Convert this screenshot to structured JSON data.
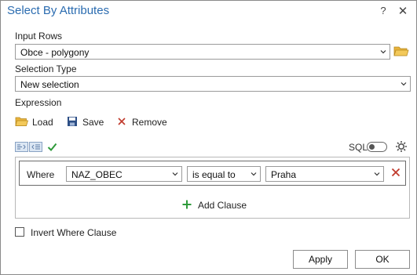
{
  "window": {
    "title": "Select By Attributes",
    "help_label": "?",
    "close_label": "✕"
  },
  "input_rows": {
    "label": "Input Rows",
    "value": "Obce - polygony"
  },
  "selection_type": {
    "label": "Selection Type",
    "value": "New selection"
  },
  "expression": {
    "label": "Expression",
    "load_label": "Load",
    "save_label": "Save",
    "remove_label": "Remove",
    "sql_label": "SQL",
    "sql_enabled": false
  },
  "clause": {
    "where_label": "Where",
    "field": "NAZ_OBEC",
    "operator": "is equal to",
    "value": "Praha"
  },
  "add_clause_label": "Add Clause",
  "invert": {
    "label": "Invert Where Clause",
    "checked": false
  },
  "buttons": {
    "apply": "Apply",
    "ok": "OK"
  },
  "colors": {
    "title": "#2b6cb0",
    "folder": "#e8b33c",
    "remove_x": "#c0392b",
    "add_plus": "#2e9a3a",
    "check": "#2e9a3a",
    "save_disk": "#2d4f86"
  },
  "icons": [
    "help-icon",
    "close-icon",
    "folder-icon",
    "chevron-down-icon",
    "load-icon",
    "save-icon",
    "remove-icon",
    "gear-icon",
    "verify-check-icon",
    "plus-icon"
  ]
}
